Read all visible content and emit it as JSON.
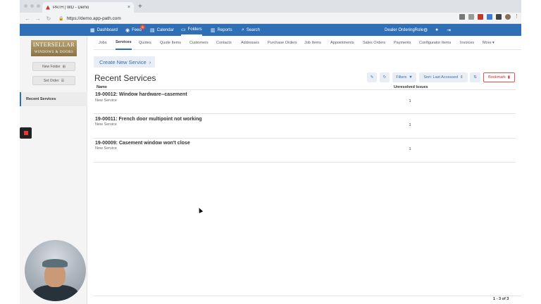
{
  "browser": {
    "tab_title": "PATH | WD - Demo",
    "tab_close": "×",
    "new_tab": "+",
    "back": "←",
    "forward": "→",
    "reload": "↻",
    "lock": "🔒",
    "url": "https://demo.app-path.com"
  },
  "topnav": {
    "items": [
      {
        "icon": "▦",
        "label": "Dashboard"
      },
      {
        "icon": "◉",
        "label": "Feed",
        "badge": "6"
      },
      {
        "icon": "▤",
        "label": "Calendar"
      },
      {
        "icon": "▭",
        "label": "Folders"
      },
      {
        "icon": "▥",
        "label": "Reports"
      },
      {
        "icon": "⌕",
        "label": "Search"
      }
    ],
    "role": "Dealer OrderingRole",
    "icons": [
      "⚙",
      "●",
      "⇥"
    ]
  },
  "sidebar": {
    "logo_line1": "INTERSELLAR",
    "logo_line2": "WINDOWS & DOORS",
    "new_folder": "New Folder",
    "new_folder_icon": "⊞",
    "set_order": "Set Order",
    "set_order_icon": "☰",
    "recent": "Recent Services"
  },
  "subnav": [
    "Jobs",
    "Services",
    "Quotes",
    "Quote Items",
    "Customers",
    "Contacts",
    "Addresses",
    "Purchase Orders",
    "Job Items",
    "Appointments",
    "Sales Orders",
    "Payments",
    "Configurator Items",
    "Invoices",
    "More ▾"
  ],
  "main": {
    "create": "Create New Service",
    "create_icon": "›",
    "heading": "Recent Services",
    "edit_icon": "✎",
    "refresh_icon": "↻",
    "filters": "Filters",
    "filter_icon": "▼",
    "sort": "Sort: Last Accessed",
    "sort_icon": "⇕",
    "sort_dir_icon": "⇅",
    "bookmark": "Bookmark",
    "bookmark_icon": "▮",
    "col_name": "Name",
    "col_issues": "Unresolved Issues",
    "rows": [
      {
        "title": "19-00012: Window hardware--casement",
        "sub": "New Service",
        "count": "1"
      },
      {
        "title": "19-00011: French door multipoint not working",
        "sub": "New Service",
        "count": "1"
      },
      {
        "title": "19-00009: Casement window won't close",
        "sub": "New Service",
        "count": "1"
      }
    ],
    "pager": "1 - 3 of 3"
  },
  "colors": {
    "primary": "#2f6fb5",
    "danger": "#d9534f"
  }
}
